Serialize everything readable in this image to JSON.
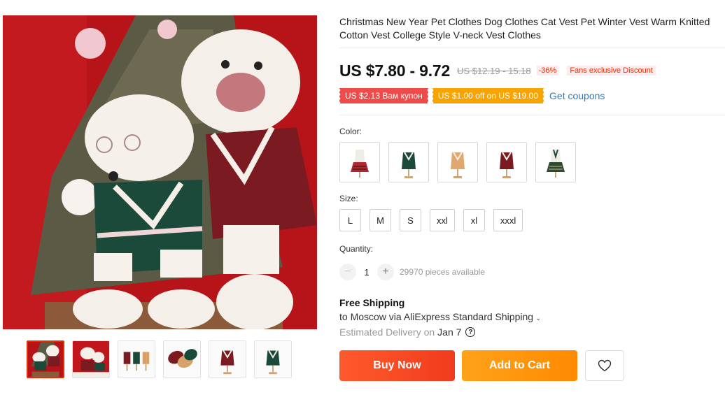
{
  "product": {
    "title": "Christmas New Year Pet Clothes Dog Clothes Cat Vest Pet Winter Vest Warm Knitted Cotton Vest College Style V-neck Vest Clothes"
  },
  "price": {
    "current": "US $7.80 - 9.72",
    "original": "US $12.19 - 15.18",
    "discount": "-36%",
    "fans_badge": "Fans exclusive Discount"
  },
  "coupons": {
    "items": [
      "US $2.13 Вам купон",
      "US $1.00 off on US $19.00"
    ],
    "get_label": "Get coupons"
  },
  "color": {
    "label": "Color:",
    "options": [
      "red-plaid-outfit",
      "green-vest",
      "tan-vest",
      "burgundy-vest",
      "green-plaid-outfit"
    ]
  },
  "size": {
    "label": "Size:",
    "options": [
      "L",
      "M",
      "S",
      "xxl",
      "xl",
      "xxxl"
    ]
  },
  "quantity": {
    "label": "Quantity:",
    "minus": "−",
    "value": "1",
    "plus": "+",
    "available": "29970 pieces available"
  },
  "shipping": {
    "title": "Free Shipping",
    "to": "to Moscow via AliExpress Standard Shipping",
    "caret": "⌄",
    "estimated_label": "Estimated Delivery on",
    "date": "Jan 7",
    "help": "?"
  },
  "actions": {
    "buy": "Buy Now",
    "cart": "Add to Cart"
  },
  "colors": {
    "accent_red": "#e62e04",
    "buy_button": "#f5411f",
    "cart_button": "#ff9a0e",
    "link": "#2e7bbf"
  }
}
